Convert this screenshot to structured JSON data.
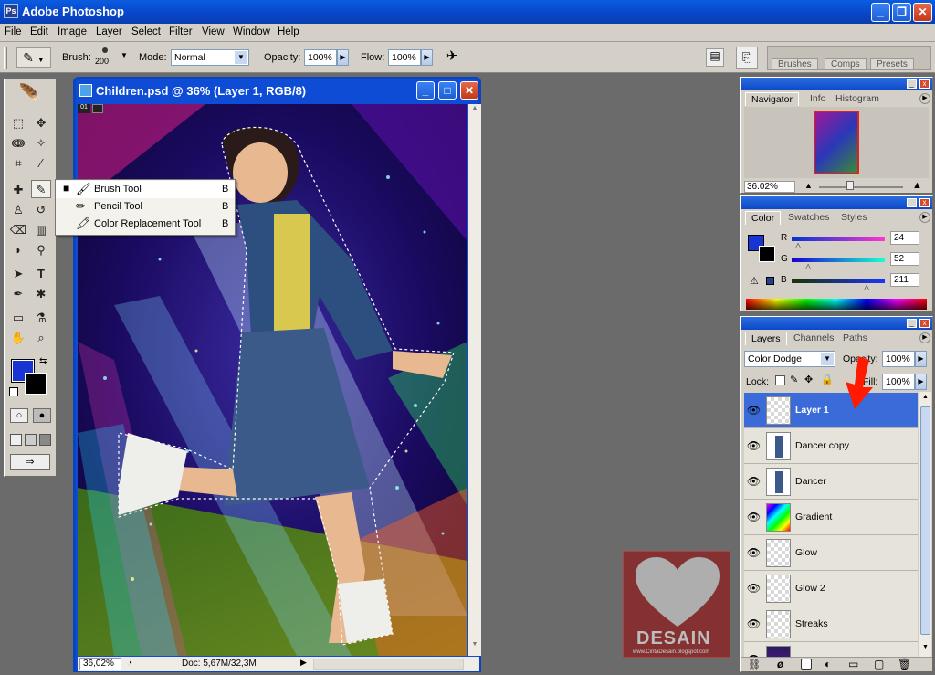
{
  "app": {
    "title": "Adobe Photoshop"
  },
  "menu": [
    "File",
    "Edit",
    "Image",
    "Layer",
    "Select",
    "Filter",
    "View",
    "Window",
    "Help"
  ],
  "options": {
    "brush_label": "Brush:",
    "brush_size": "200",
    "mode_label": "Mode:",
    "mode_value": "Normal",
    "opacity_label": "Opacity:",
    "opacity_value": "100%",
    "flow_label": "Flow:",
    "flow_value": "100%",
    "well_tabs": [
      "Brushes",
      "Comps",
      "Presets"
    ]
  },
  "document": {
    "title": "Children.psd @ 36% (Layer 1, RGB/8)",
    "zoom": "36,02%",
    "doc_info": "Doc: 5,67M/32,3M",
    "tag": "01"
  },
  "flyout": {
    "items": [
      {
        "label": "Brush Tool",
        "key": "B",
        "active": true,
        "icon": "brush-icon"
      },
      {
        "label": "Pencil Tool",
        "key": "B",
        "active": false,
        "icon": "pencil-icon"
      },
      {
        "label": "Color Replacement Tool",
        "key": "B",
        "active": false,
        "icon": "color-replacement-icon"
      }
    ]
  },
  "navigator": {
    "tabs": [
      "Navigator",
      "Info",
      "Histogram"
    ],
    "zoom": "36.02%"
  },
  "color_panel": {
    "tabs": [
      "Color",
      "Swatches",
      "Styles"
    ],
    "r_label": "R",
    "g_label": "G",
    "b_label": "B",
    "r": "24",
    "g": "52",
    "b": "211",
    "foreground": "#1834d3",
    "background": "#000000"
  },
  "layers_panel": {
    "tabs": [
      "Layers",
      "Channels",
      "Paths"
    ],
    "blend_mode": "Color Dodge",
    "opacity_label": "Opacity:",
    "opacity": "100%",
    "lock_label": "Lock:",
    "fill_label": "Fill:",
    "fill": "100%",
    "layers": [
      {
        "name": "Layer 1",
        "selected": true
      },
      {
        "name": "Dancer copy",
        "selected": false
      },
      {
        "name": "Dancer",
        "selected": false
      },
      {
        "name": "Gradient",
        "selected": false
      },
      {
        "name": "Glow",
        "selected": false
      },
      {
        "name": "Glow 2",
        "selected": false
      },
      {
        "name": "Streaks",
        "selected": false
      }
    ]
  },
  "watermark": {
    "text": "DESAIN",
    "url": "www.CintaDesain.blogspot.com"
  },
  "colors": {
    "accent": "#0a5ce0",
    "selection": "#3a6bd8",
    "arrow": "#ff1a00"
  }
}
